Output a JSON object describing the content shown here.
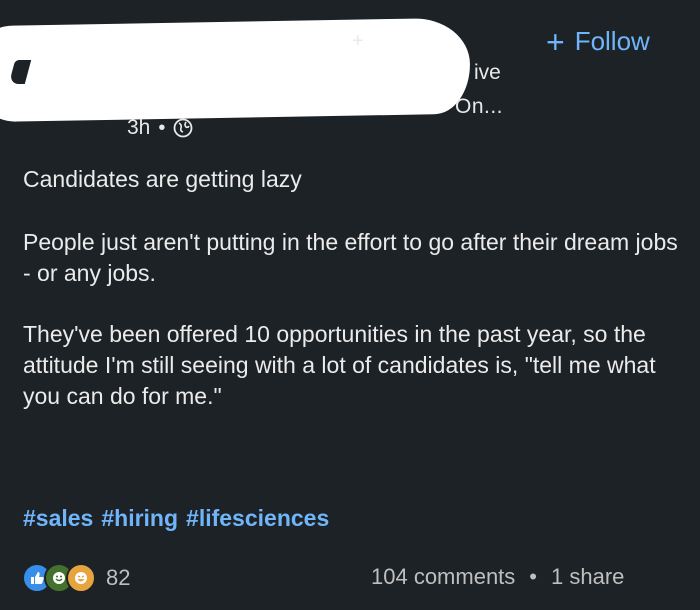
{
  "header": {
    "name_suffix": "+",
    "headline_fragment": "ive",
    "subtitle_fragment": "On...",
    "time": "3h",
    "separator": "•",
    "follow_label": "Follow",
    "follow_icon": "plus-icon",
    "visibility_icon": "globe-icon"
  },
  "post": {
    "paragraphs": [
      "Candidates are getting lazy",
      "People just aren't putting in the effort to go after their dream jobs - or any jobs.",
      "They've been offered 10 opportunities in the past year, so the attitude I'm still seeing with a lot of candidates is, \"tell me what you can do for me.\""
    ],
    "hashtags": [
      "#sales",
      "#hiring",
      "#lifesciences"
    ]
  },
  "footer": {
    "reaction_icons": [
      "like-icon",
      "celebrate-icon",
      "funny-icon"
    ],
    "reaction_count": "82",
    "comments": "104 comments",
    "separator": "•",
    "shares": "1 share"
  },
  "colors": {
    "background": "#1d2226",
    "accent": "#70b5f9",
    "text": "#ebebeb",
    "muted": "#bfbfbf"
  }
}
